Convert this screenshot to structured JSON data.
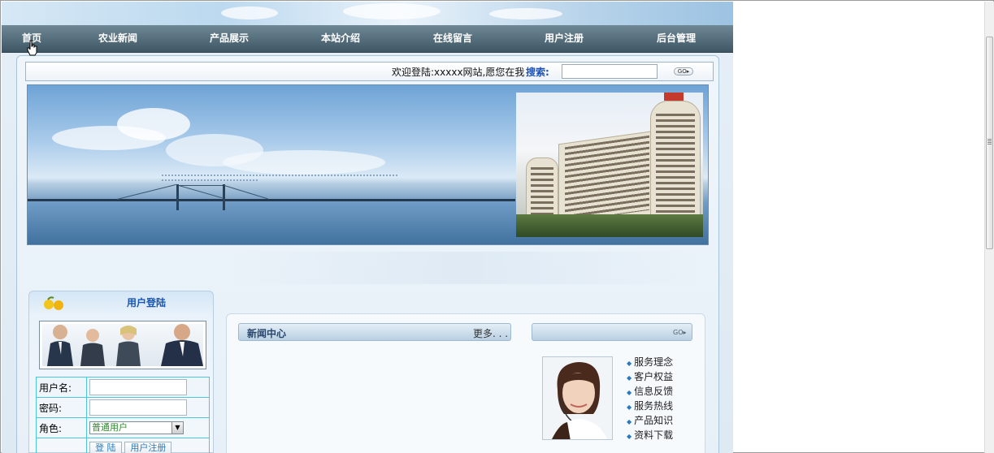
{
  "nav": {
    "items": [
      "首页",
      "农业新闻",
      "产品展示",
      "本站介绍",
      "在线留言",
      "用户注册",
      "后台管理"
    ]
  },
  "welcome": {
    "text": "欢迎登陆:xxxxx网站,愿您在我",
    "search_label": "搜索:",
    "search_value": "",
    "go_label": "GO"
  },
  "login": {
    "title": "用户登陆",
    "username_label": "用户名:",
    "password_label": "密码:",
    "role_label": "角色:",
    "role_value": "普通用户",
    "login_button": "登 陆",
    "register_button": "用户注册"
  },
  "news": {
    "title": "新闻中心",
    "more": "更多. . .",
    "right_go": "GO"
  },
  "services": {
    "links": [
      "服务理念",
      "客户权益",
      "信息反馈",
      "服务热线",
      "产品知识",
      "资料下载"
    ]
  },
  "colors": {
    "nav_bg": "#4f6877",
    "accent_blue": "#1955b3",
    "table_border": "#4cc7d8"
  }
}
